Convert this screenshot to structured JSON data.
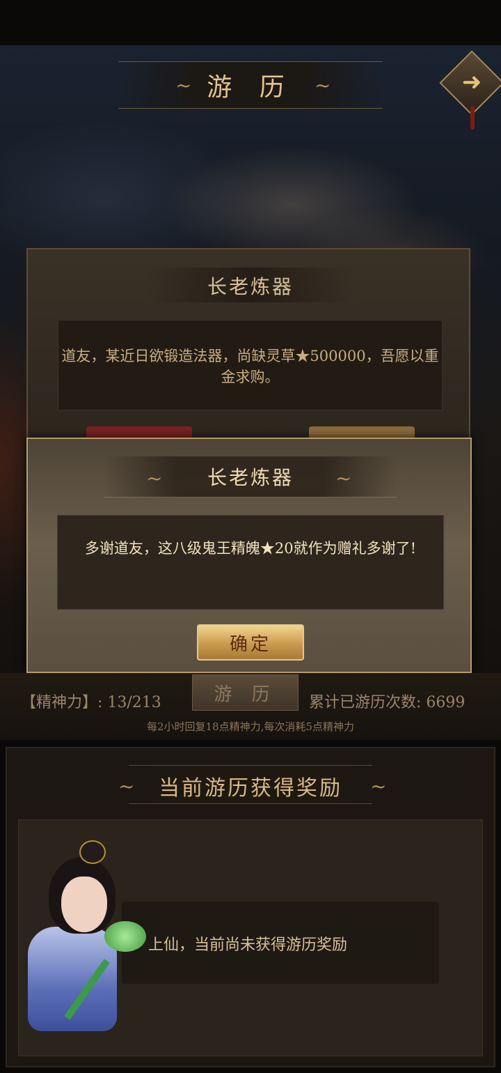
{
  "header": {
    "title": "游 历",
    "exit_icon": "arrow-right-icon"
  },
  "event_card": {
    "title": "长老炼器",
    "message": "道友，某近日欲锻造法器，尚缺灵草★500000，吾愿以重金求购。"
  },
  "dialog": {
    "title": "长老炼器",
    "message": "多谢道友，这八级鬼王精魄★20就作为赠礼多谢了!",
    "confirm_label": "确定"
  },
  "stamina": {
    "spirit_label": "【精神力】: 13/213",
    "travel_button": "游 历",
    "count_label": "累计已游历次数: 6699",
    "regen_text": "每2小时回复18点精神力,每次消耗5点精神力"
  },
  "reward": {
    "title": "当前游历获得奖励",
    "message": "上仙，当前尚未获得游历奖励"
  },
  "colors": {
    "accent_gold": "#e2c48e",
    "confirm_button": "#d9a95a"
  }
}
